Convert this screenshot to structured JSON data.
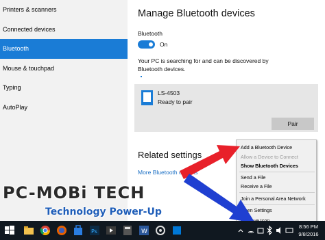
{
  "sidebar": {
    "items": [
      {
        "label": "Printers & scanners"
      },
      {
        "label": "Connected devices"
      },
      {
        "label": "Bluetooth"
      },
      {
        "label": "Mouse & touchpad"
      },
      {
        "label": "Typing"
      },
      {
        "label": "AutoPlay"
      }
    ]
  },
  "main": {
    "title": "Manage Bluetooth devices",
    "bluetooth_label": "Bluetooth",
    "toggle_state": "On",
    "search_text": "Your PC is searching for and can be discovered by Bluetooth devices.",
    "device": {
      "name": "LS-4503",
      "status": "Ready to pair",
      "pair_label": "Pair"
    },
    "related_title": "Related settings",
    "related_link": "More Bluetooth options"
  },
  "context_menu": {
    "items": [
      {
        "label": "Add a Bluetooth Device",
        "state": "normal"
      },
      {
        "label": "Allow a Device to Connect",
        "state": "disabled"
      },
      {
        "label": "Show Bluetooth Devices",
        "state": "bold"
      },
      {
        "label": "Send a File",
        "state": "normal"
      },
      {
        "label": "Receive a File",
        "state": "normal"
      },
      {
        "label": "Join a Personal Area Network",
        "state": "normal"
      },
      {
        "label": "Open Settings",
        "state": "normal"
      },
      {
        "label": "Remove Icon",
        "state": "normal"
      }
    ]
  },
  "watermark": {
    "main": "PC-MOBi TECH",
    "sub": "Technology Power-Up"
  },
  "taskbar": {
    "time": "8:56 PM",
    "date": "9/8/2016"
  },
  "colors": {
    "accent": "#1a7cd6",
    "arrow_red": "#e8202a",
    "arrow_blue": "#1f3fd1"
  }
}
